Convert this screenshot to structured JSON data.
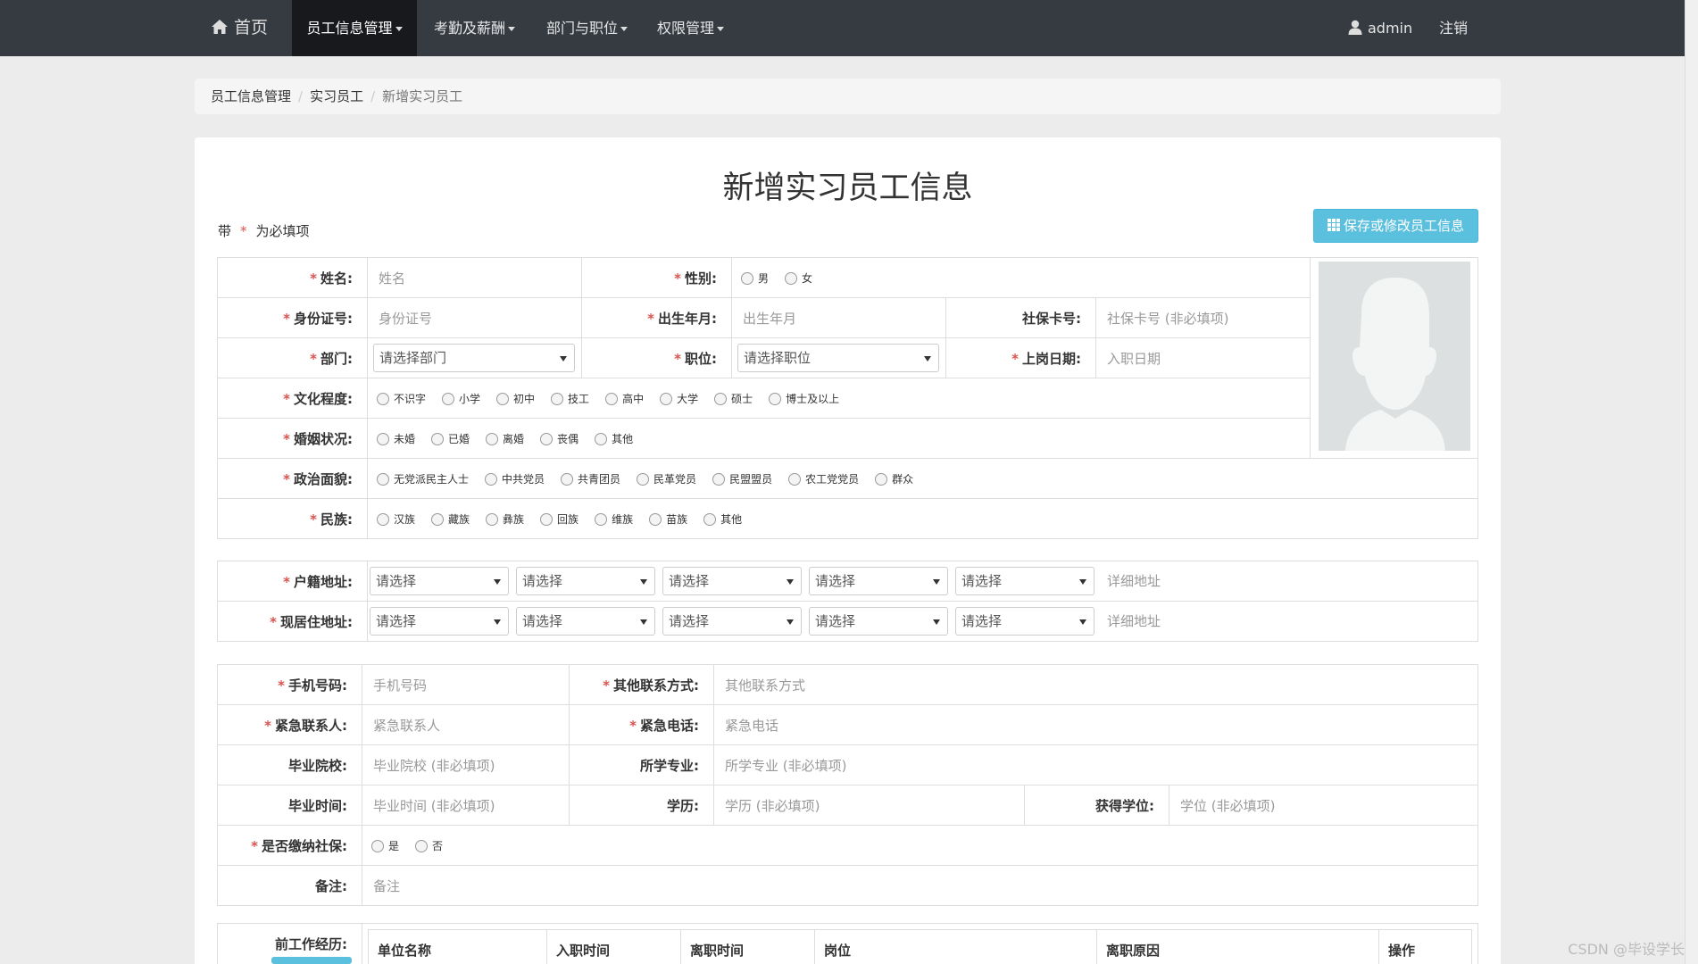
{
  "nav": {
    "home": "首页",
    "items": [
      "员工信息管理",
      "考勤及薪酬",
      "部门与职位",
      "权限管理"
    ],
    "user": "admin",
    "logout": "注销"
  },
  "breadcrumb": [
    "员工信息管理",
    "实习员工",
    "新增实习员工"
  ],
  "page_title": "新增实习员工信息",
  "required_note": {
    "prefix": "带",
    "star": "*",
    "suffix": "为必填项"
  },
  "save_button": "保存或修改员工信息",
  "basic": {
    "name": {
      "label": "姓名:",
      "placeholder": "姓名"
    },
    "gender": {
      "label": "性别:",
      "options": [
        "男",
        "女"
      ]
    },
    "idcard": {
      "label": "身份证号:",
      "placeholder": "身份证号"
    },
    "birth": {
      "label": "出生年月:",
      "placeholder": "出生年月"
    },
    "social_card": {
      "label": "社保卡号:",
      "placeholder": "社保卡号 (非必填项)"
    },
    "dept": {
      "label": "部门:",
      "value": "请选择部门"
    },
    "position": {
      "label": "职位:",
      "value": "请选择职位"
    },
    "start_date": {
      "label": "上岗日期:",
      "placeholder": "入职日期"
    },
    "education": {
      "label": "文化程度:",
      "options": [
        "不识字",
        "小学",
        "初中",
        "技工",
        "高中",
        "大学",
        "硕士",
        "博士及以上"
      ]
    },
    "marital": {
      "label": "婚姻状况:",
      "options": [
        "未婚",
        "已婚",
        "离婚",
        "丧偶",
        "其他"
      ]
    },
    "political": {
      "label": "政治面貌:",
      "options": [
        "无党派民主人士",
        "中共党员",
        "共青团员",
        "民革党员",
        "民盟盟员",
        "农工党党员",
        "群众"
      ]
    },
    "ethnic": {
      "label": "民族:",
      "options": [
        "汉族",
        "藏族",
        "彝族",
        "回族",
        "维族",
        "苗族",
        "其他"
      ]
    }
  },
  "address": {
    "hukou": {
      "label": "户籍地址:",
      "selects": [
        "请选择",
        "请选择",
        "请选择",
        "请选择",
        "请选择"
      ],
      "detail": "详细地址"
    },
    "current": {
      "label": "现居住地址:",
      "selects": [
        "请选择",
        "请选择",
        "请选择",
        "请选择",
        "请选择"
      ],
      "detail": "详细地址"
    }
  },
  "contact": {
    "phone": {
      "label": "手机号码:",
      "placeholder": "手机号码"
    },
    "other_contact": {
      "label": "其他联系方式:",
      "placeholder": "其他联系方式"
    },
    "emergency_person": {
      "label": "紧急联系人:",
      "placeholder": "紧急联系人"
    },
    "emergency_phone": {
      "label": "紧急电话:",
      "placeholder": "紧急电话"
    },
    "school": {
      "label": "毕业院校:",
      "placeholder": "毕业院校 (非必填项)"
    },
    "major": {
      "label": "所学专业:",
      "placeholder": "所学专业 (非必填项)"
    },
    "grad_time": {
      "label": "毕业时间:",
      "placeholder": "毕业时间 (非必填项)"
    },
    "edu": {
      "label": "学历:",
      "placeholder": "学历 (非必填项)"
    },
    "degree": {
      "label": "获得学位:",
      "placeholder": "学位 (非必填项)"
    },
    "social_ins": {
      "label": "是否缴纳社保:",
      "options": [
        "是",
        "否"
      ]
    },
    "remark": {
      "label": "备注:",
      "placeholder": "备注"
    }
  },
  "work_history": {
    "label": "前工作经历:",
    "headers": [
      "单位名称",
      "入职时间",
      "离职时间",
      "岗位",
      "离职原因",
      "操作"
    ]
  },
  "watermark": "CSDN @毕设学长"
}
